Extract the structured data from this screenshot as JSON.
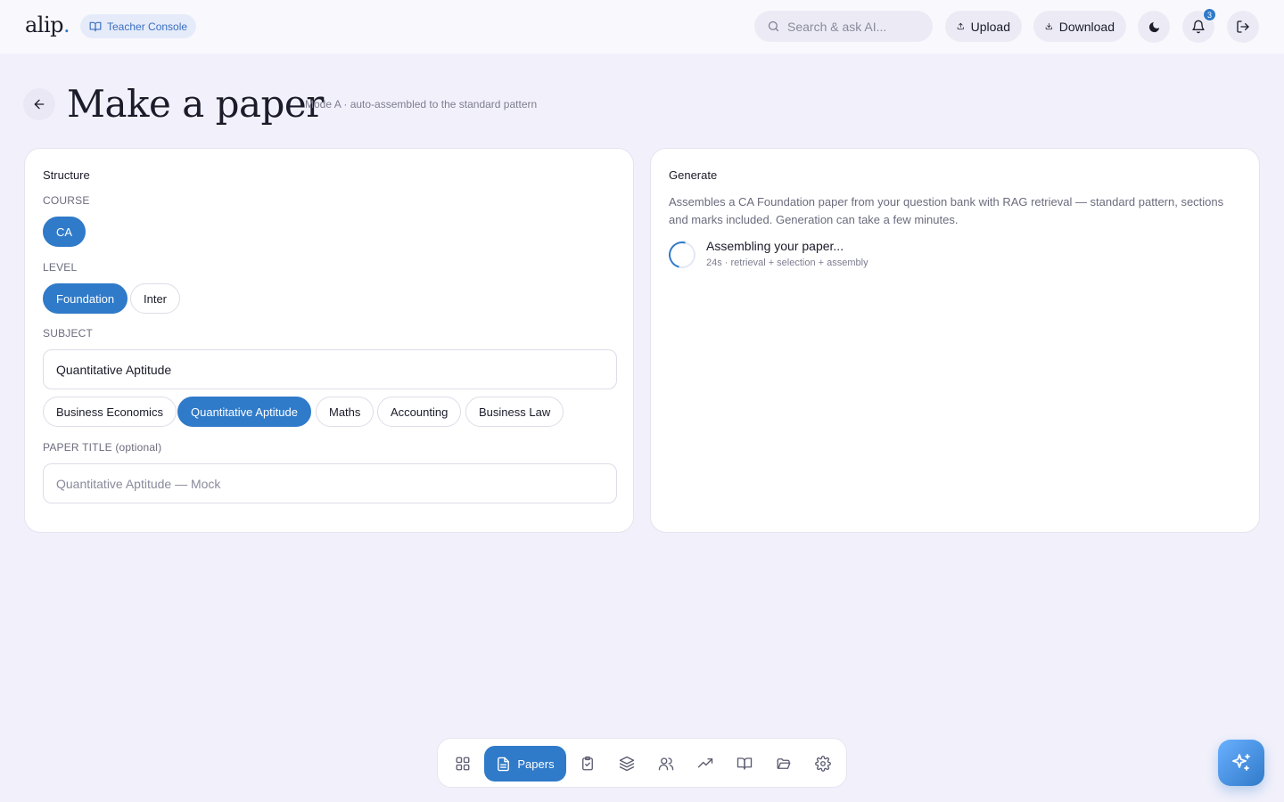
{
  "app": {
    "logo_text": "alip",
    "logo_dot": ".",
    "console_label": "Teacher Console"
  },
  "topbar": {
    "search_placeholder": "Search & ask AI...",
    "upload_label": "Upload",
    "download_label": "Download",
    "notification_count": "3"
  },
  "header": {
    "title": "Make a paper",
    "subtitle": "Mode A · auto-assembled to the standard pattern"
  },
  "structure": {
    "title": "Structure",
    "course_label": "COURSE",
    "course_options": [
      "CA"
    ],
    "course_selected": "CA",
    "level_label": "LEVEL",
    "level_options": [
      "Foundation",
      "Inter"
    ],
    "level_selected": "Foundation",
    "subject_label": "SUBJECT",
    "subject_value": "Quantitative Aptitude",
    "subject_options": [
      "Business Economics",
      "Quantitative Aptitude",
      "Maths",
      "Accounting",
      "Business Law"
    ],
    "subject_selected": "Quantitative Aptitude",
    "paper_title_label": "PAPER TITLE (optional)",
    "paper_title_placeholder": "Quantitative Aptitude — Mock"
  },
  "generate": {
    "title": "Generate",
    "description": "Assembles a CA Foundation paper from your question bank with RAG retrieval — standard pattern, sections and marks included. Generation can take a few minutes.",
    "status_title": "Assembling your paper...",
    "status_sub": "24s · retrieval + selection + assembly"
  },
  "dock": {
    "active_label": "Papers",
    "items": [
      "dashboard",
      "papers",
      "tasks",
      "layers",
      "users",
      "trends",
      "library",
      "folders",
      "settings"
    ]
  },
  "colors": {
    "accent": "#2f7ac9",
    "background": "#f2f1fb"
  }
}
